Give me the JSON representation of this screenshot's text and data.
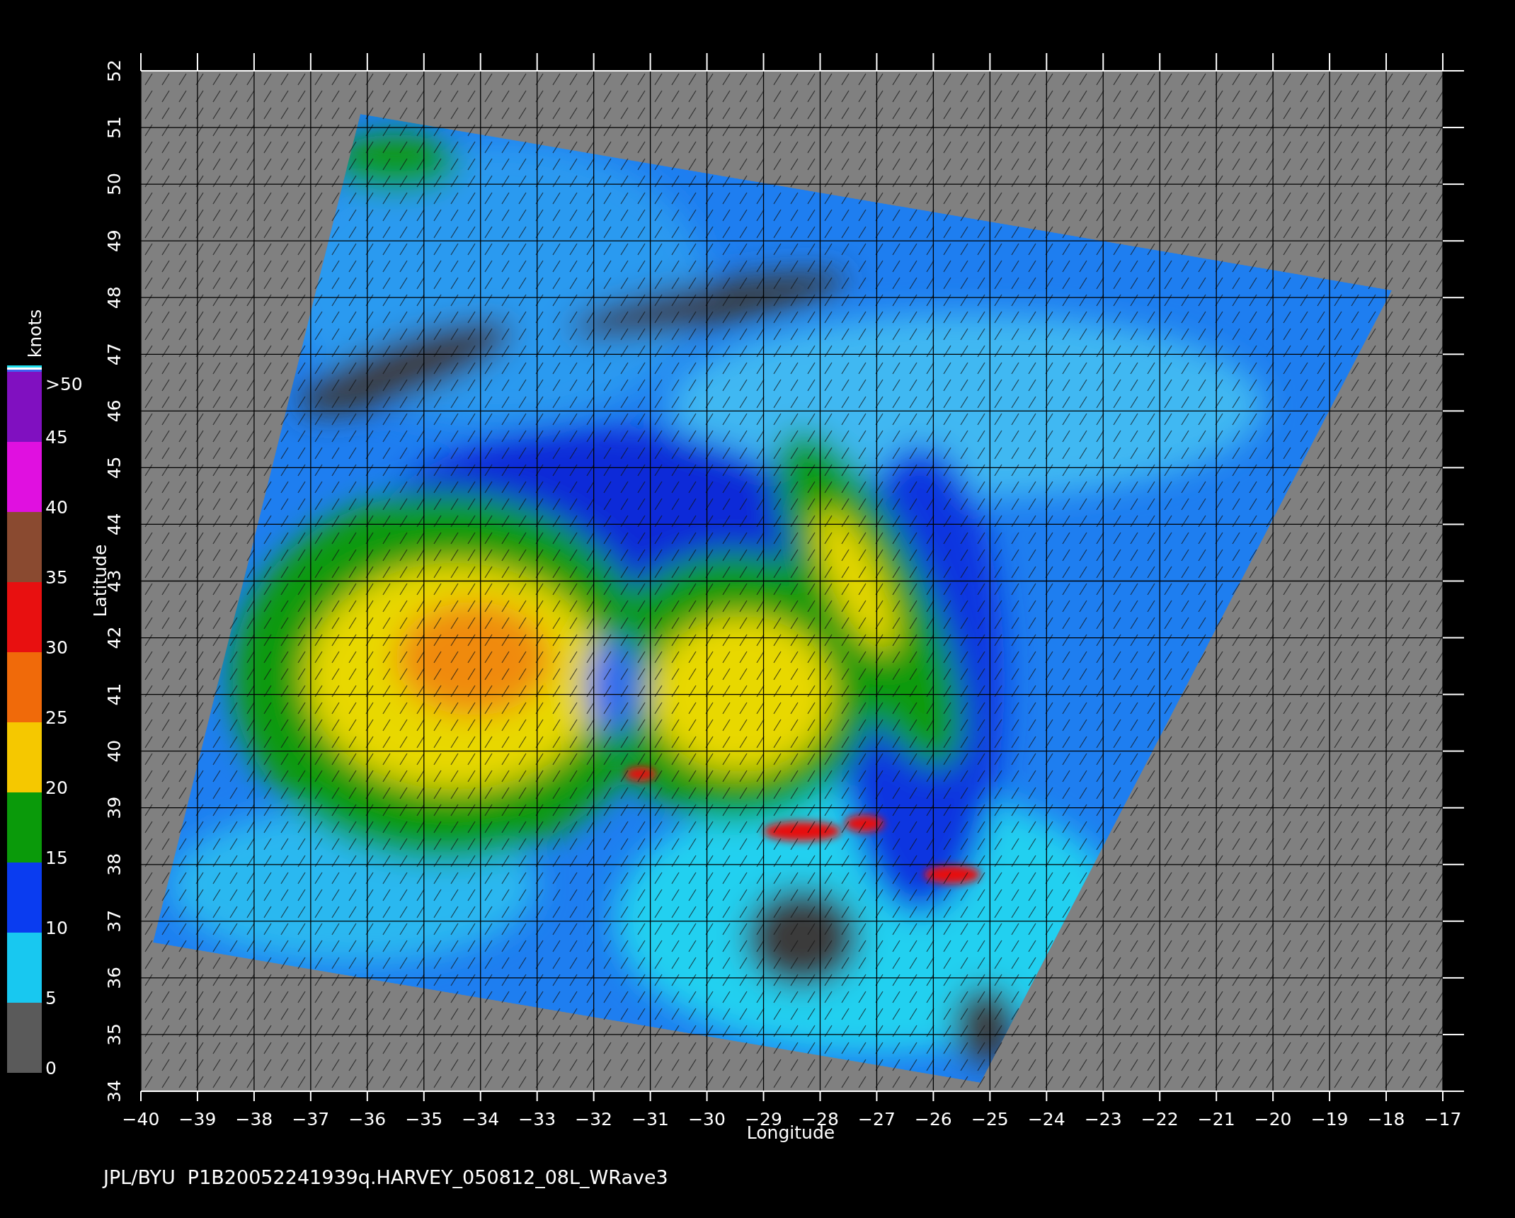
{
  "plot": {
    "x_axis": {
      "label": "Longitude",
      "ticks": [
        "−40",
        "−39",
        "−38",
        "−37",
        "−36",
        "−35",
        "−34",
        "−33",
        "−32",
        "−31",
        "−30",
        "−29",
        "−28",
        "−27",
        "−26",
        "−25",
        "−24",
        "−23",
        "−22",
        "−21",
        "−20",
        "−19",
        "−18",
        "−17"
      ]
    },
    "y_axis": {
      "label": "Latitude",
      "ticks": [
        "34",
        "35",
        "36",
        "37",
        "38",
        "39",
        "40",
        "41",
        "42",
        "43",
        "44",
        "45",
        "46",
        "47",
        "48",
        "49",
        "50",
        "51",
        "52"
      ]
    }
  },
  "colorbar": {
    "unit": "knots",
    "bands": [
      {
        "color": "#8010c0"
      },
      {
        "color": "#e010e0"
      },
      {
        "color": "#8a4a30"
      },
      {
        "color": "#e81010"
      },
      {
        "color": "#f06a0a"
      },
      {
        "color": "#f5c800"
      },
      {
        "color": "#0a9a0a"
      },
      {
        "color": "#0a3cf0"
      },
      {
        "color": "#18c8f0"
      },
      {
        "color": "#5a5a5a"
      }
    ],
    "labels": [
      ">50",
      "45",
      "40",
      "35",
      "30",
      "25",
      "20",
      "15",
      "10",
      "5",
      "0"
    ]
  },
  "caption": "JPL/BYU  P1B20052241939q.HARVEY_050812_08L_WRave3"
}
